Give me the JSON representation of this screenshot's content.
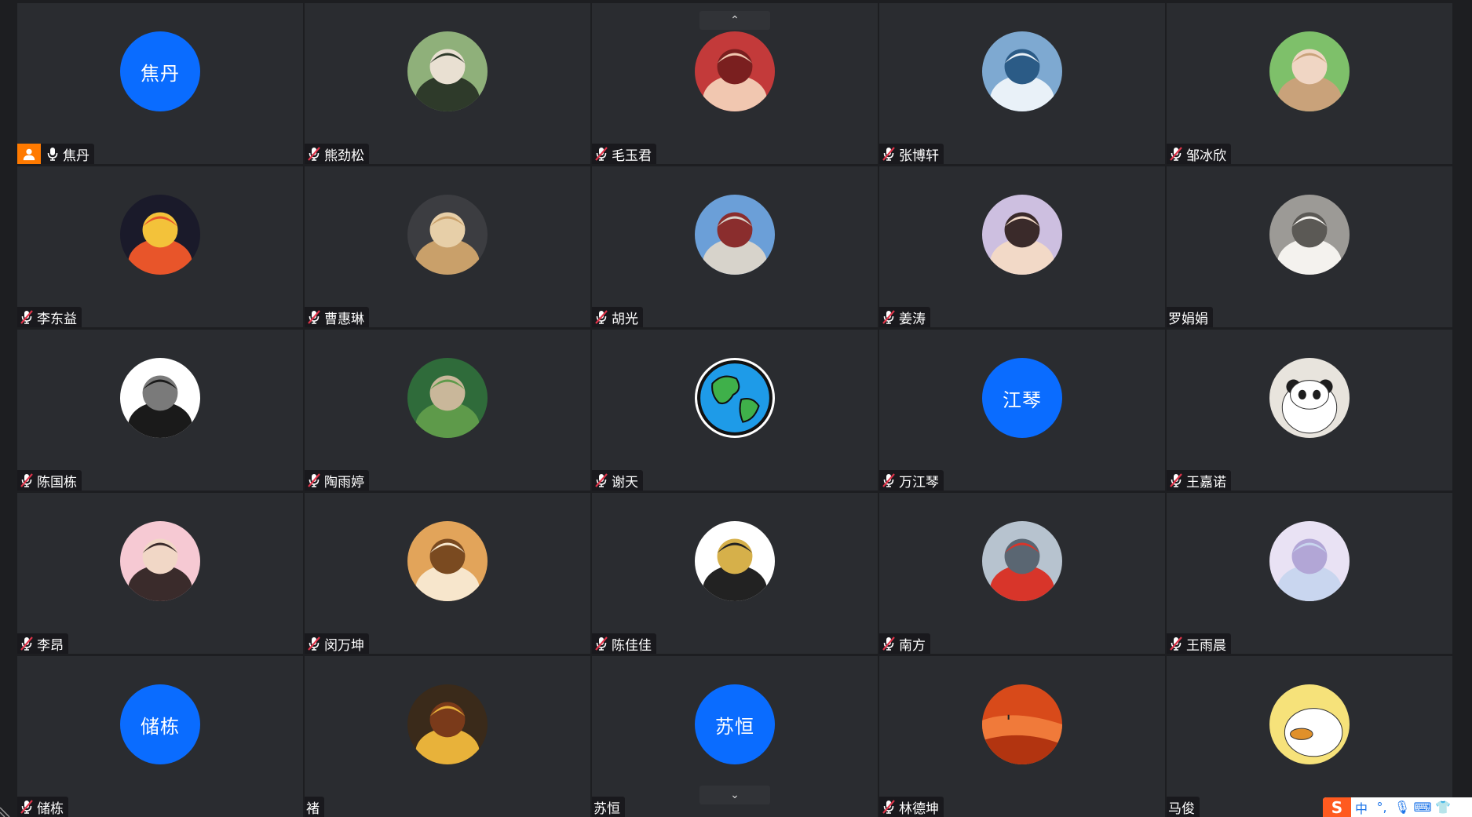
{
  "pager": {
    "up_label": "⌃",
    "down_label": "⌄"
  },
  "participants": [
    {
      "name": "焦丹",
      "avatar": {
        "type": "text",
        "text": "焦丹",
        "color": "#0a6cff"
      },
      "host": true,
      "mic": "on"
    },
    {
      "name": "熊劲松",
      "avatar": {
        "type": "image",
        "icon": "anime-girl-avatar"
      },
      "mic": "muted"
    },
    {
      "name": "毛玉君",
      "avatar": {
        "type": "image",
        "icon": "child-red-hat-avatar"
      },
      "mic": "muted"
    },
    {
      "name": "张博轩",
      "avatar": {
        "type": "image",
        "icon": "seaside-person-avatar"
      },
      "mic": "muted"
    },
    {
      "name": "邹冰欣",
      "avatar": {
        "type": "image",
        "icon": "baby-straw-hat-avatar"
      },
      "mic": "muted"
    },
    {
      "name": "李东益",
      "avatar": {
        "type": "image",
        "icon": "koi-fish-avatar"
      },
      "mic": "muted"
    },
    {
      "name": "曹惠琳",
      "avatar": {
        "type": "image",
        "icon": "hamster-avatar"
      },
      "mic": "muted"
    },
    {
      "name": "胡光",
      "avatar": {
        "type": "image",
        "icon": "potala-palace-avatar"
      },
      "mic": "muted"
    },
    {
      "name": "姜涛",
      "avatar": {
        "type": "image",
        "icon": "cartoon-face-avatar"
      },
      "mic": "muted"
    },
    {
      "name": "罗娟娟",
      "avatar": {
        "type": "image",
        "icon": "white-dog-avatar"
      },
      "mic": "none"
    },
    {
      "name": "陈国栋",
      "avatar": {
        "type": "image",
        "icon": "masked-anime-avatar"
      },
      "mic": "muted"
    },
    {
      "name": "陶雨婷",
      "avatar": {
        "type": "image",
        "icon": "forest-girl-avatar"
      },
      "mic": "muted"
    },
    {
      "name": "谢天",
      "avatar": {
        "type": "image",
        "icon": "earth-globe-avatar"
      },
      "mic": "muted"
    },
    {
      "name": "万江琴",
      "avatar": {
        "type": "text",
        "text": "江琴",
        "color": "#0a6cff"
      },
      "mic": "muted"
    },
    {
      "name": "王嘉诺",
      "avatar": {
        "type": "image",
        "icon": "panda-bear-avatar"
      },
      "mic": "muted"
    },
    {
      "name": "李昂",
      "avatar": {
        "type": "image",
        "icon": "chibi-boy-avatar"
      },
      "mic": "muted"
    },
    {
      "name": "闵万坤",
      "avatar": {
        "type": "image",
        "icon": "orange-cat-avatar"
      },
      "mic": "muted"
    },
    {
      "name": "陈佳佳",
      "avatar": {
        "type": "image",
        "icon": "sketch-figure-avatar"
      },
      "mic": "muted"
    },
    {
      "name": "南方",
      "avatar": {
        "type": "image",
        "icon": "red-toy-avatar"
      },
      "mic": "muted"
    },
    {
      "name": "王雨晨",
      "avatar": {
        "type": "image",
        "icon": "pastel-cat-avatar"
      },
      "mic": "muted"
    },
    {
      "name": "储栋",
      "avatar": {
        "type": "text",
        "text": "储栋",
        "color": "#0a6cff"
      },
      "mic": "muted"
    },
    {
      "name": "褚",
      "avatar": {
        "type": "image",
        "icon": "jojo-anime-avatar"
      },
      "mic": "none"
    },
    {
      "name": "苏恒",
      "avatar": {
        "type": "text",
        "text": "苏恒",
        "color": "#0a6cff"
      },
      "mic": "none"
    },
    {
      "name": "林德坤",
      "avatar": {
        "type": "image",
        "icon": "desert-dunes-avatar"
      },
      "mic": "muted"
    },
    {
      "name": "马俊",
      "avatar": {
        "type": "image",
        "icon": "yellow-duck-avatar"
      },
      "mic": "none"
    }
  ],
  "ime": {
    "logo": "S",
    "items": [
      "中",
      "°,",
      "🎙",
      "⌨",
      "👕"
    ]
  },
  "colors": {
    "tile_bg": "#2a2c30",
    "page_bg": "#1d1e21",
    "text_avatar_bg": "#0a6cff",
    "host_badge": "#ff7a00",
    "muted_mic": "#e0344a"
  }
}
